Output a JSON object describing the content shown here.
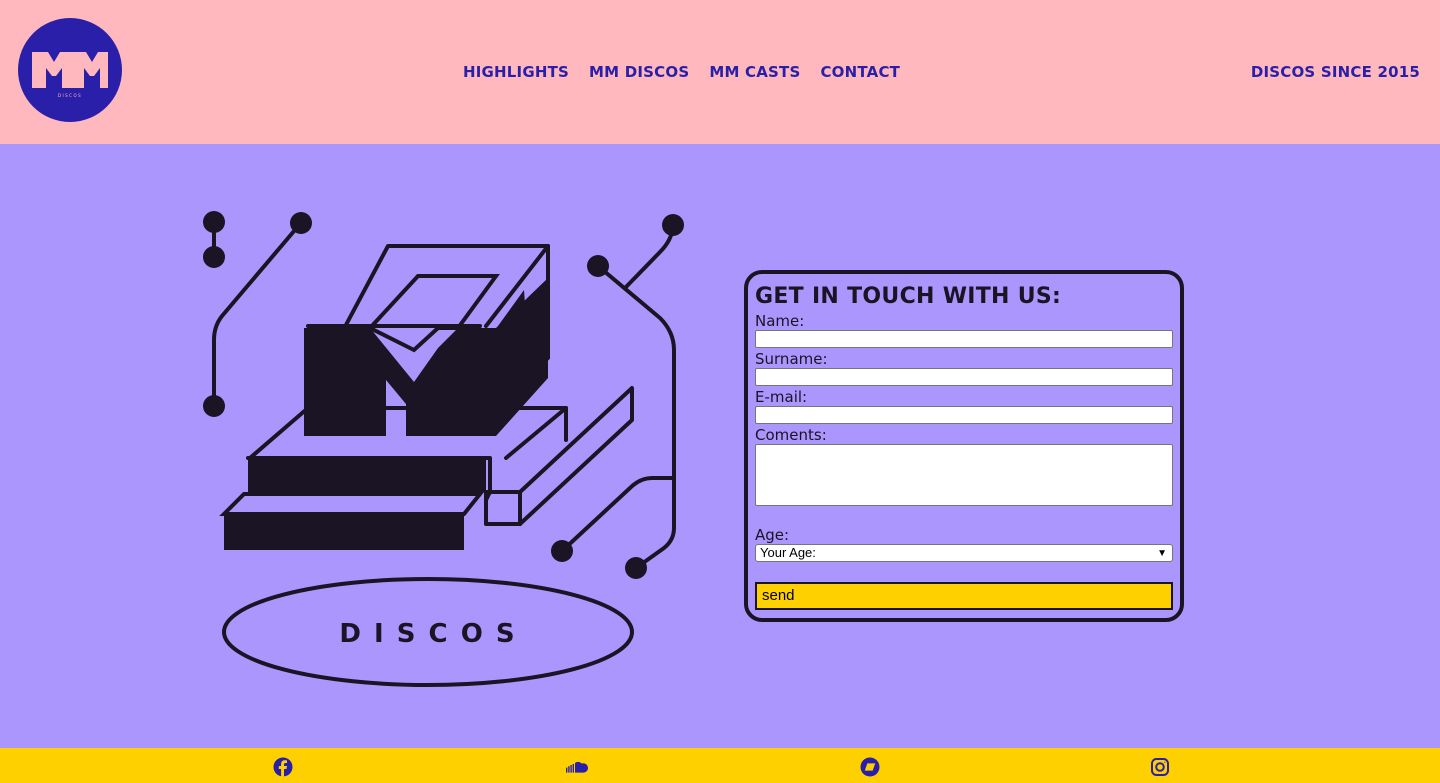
{
  "header": {
    "logo_text": "MM",
    "logo_subtext": "DISCOS",
    "nav": [
      {
        "label": "HIGHLIGHTS"
      },
      {
        "label": "MM DISCOS"
      },
      {
        "label": "MM CASTS"
      },
      {
        "label": "CONTACT"
      }
    ],
    "tagline": "DISCOS SINCE 2015"
  },
  "illustration": {
    "logo_word": "D I S C O S"
  },
  "form": {
    "title": "GET IN TOUCH WITH US:",
    "name_label": "Name:",
    "surname_label": "Surname:",
    "email_label": "E-mail:",
    "comments_label": "Coments:",
    "age_label": "Age:",
    "age_selected": "Your Age:",
    "send_label": "send"
  },
  "footer": {
    "icons": [
      "facebook-icon",
      "soundcloud-icon",
      "bandcamp-icon",
      "instagram-icon"
    ]
  },
  "colors": {
    "header_bg": "#ffb8bd",
    "main_bg": "#ab96fe",
    "footer_bg": "#ffd000",
    "brand_blue": "#2a1fa8",
    "ink": "#1a1424"
  }
}
